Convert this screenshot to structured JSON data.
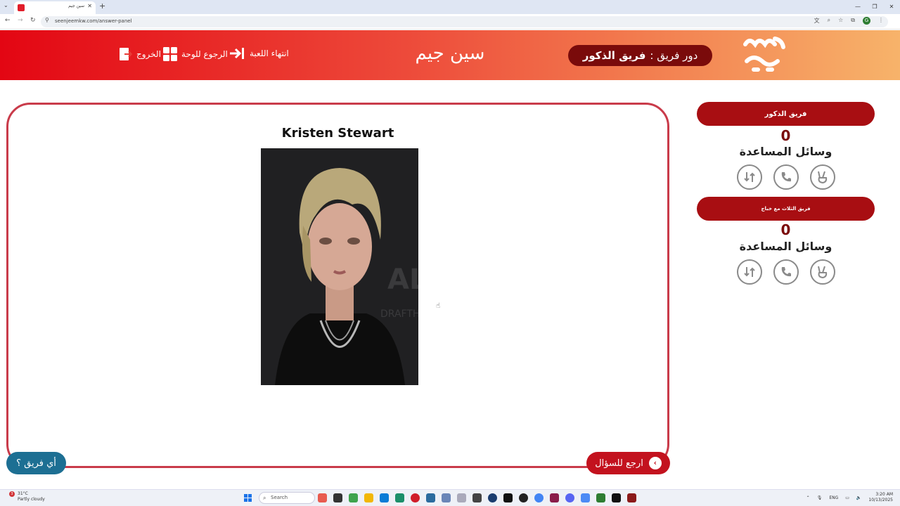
{
  "browser": {
    "tab_title": "سين جيم",
    "url": "seenjeemkw.com/answer-panel",
    "new_tab": "+",
    "close_tab": "✕",
    "window": {
      "minimize": "—",
      "maximize": "❐",
      "close": "✕"
    }
  },
  "header": {
    "turn_label": "دور فريق :",
    "turn_team": "فريق الذكور",
    "site_title": "سين جيم",
    "end_game": "انتهاء اللعبة",
    "back_to_board": "الرجوع للوحة",
    "exit": "الخروج"
  },
  "main": {
    "answer_name": "Kristen Stewart",
    "back_to_question": "ارجع للسؤال",
    "which_team": "أي فريق ؟"
  },
  "teams": [
    {
      "name": "فريق الذكور",
      "score": "0",
      "helps_label": "وسائل المساعدة"
    },
    {
      "name": "فريق الثلاث مع خباج",
      "score": "0",
      "helps_label": "وسائل المساعدة"
    }
  ],
  "taskbar": {
    "weather_temp": "31°C",
    "weather_desc": "Partly cloudy",
    "weather_badge": "3",
    "search_placeholder": "Search",
    "lang": "ENG",
    "time": "3:20 AM",
    "date": "10/13/2025"
  },
  "colors": {
    "brand_red": "#e30613",
    "dark_red": "#7a0b0b",
    "team_pill": "#a80e12",
    "back_button": "#c3121e",
    "team_button": "#1d6f93"
  }
}
